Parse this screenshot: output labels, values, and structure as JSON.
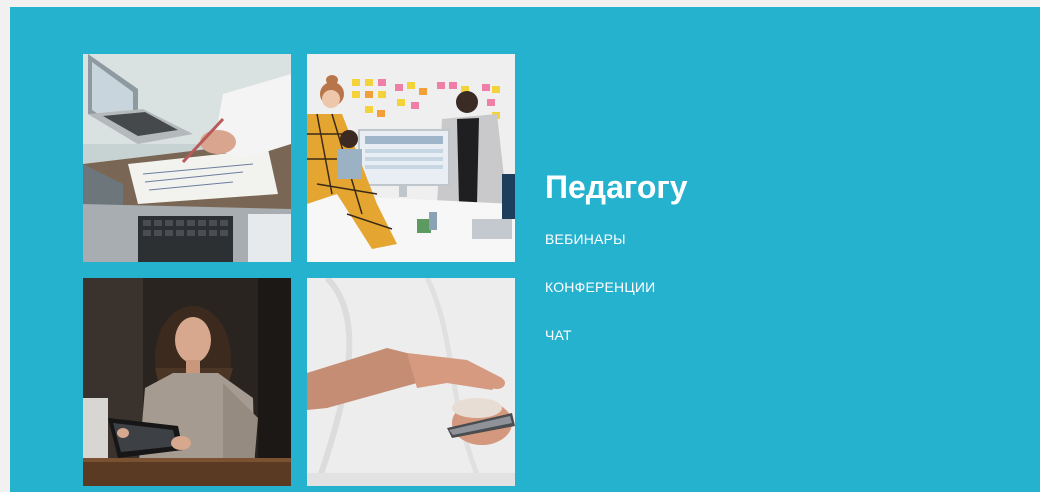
{
  "section": {
    "title": "Педагогу",
    "links": [
      {
        "label": "ВЕБИНАРЫ"
      },
      {
        "label": "КОНФЕРЕНЦИИ"
      },
      {
        "label": "ЧАТ"
      }
    ]
  },
  "colors": {
    "panel_background": "#25b2cf",
    "page_background": "#f1f1f1",
    "text": "#ffffff"
  },
  "images": [
    {
      "name": "laptops-desk-photo"
    },
    {
      "name": "team-meeting-photo"
    },
    {
      "name": "woman-with-tablet-photo"
    },
    {
      "name": "hand-phone-photo"
    }
  ]
}
